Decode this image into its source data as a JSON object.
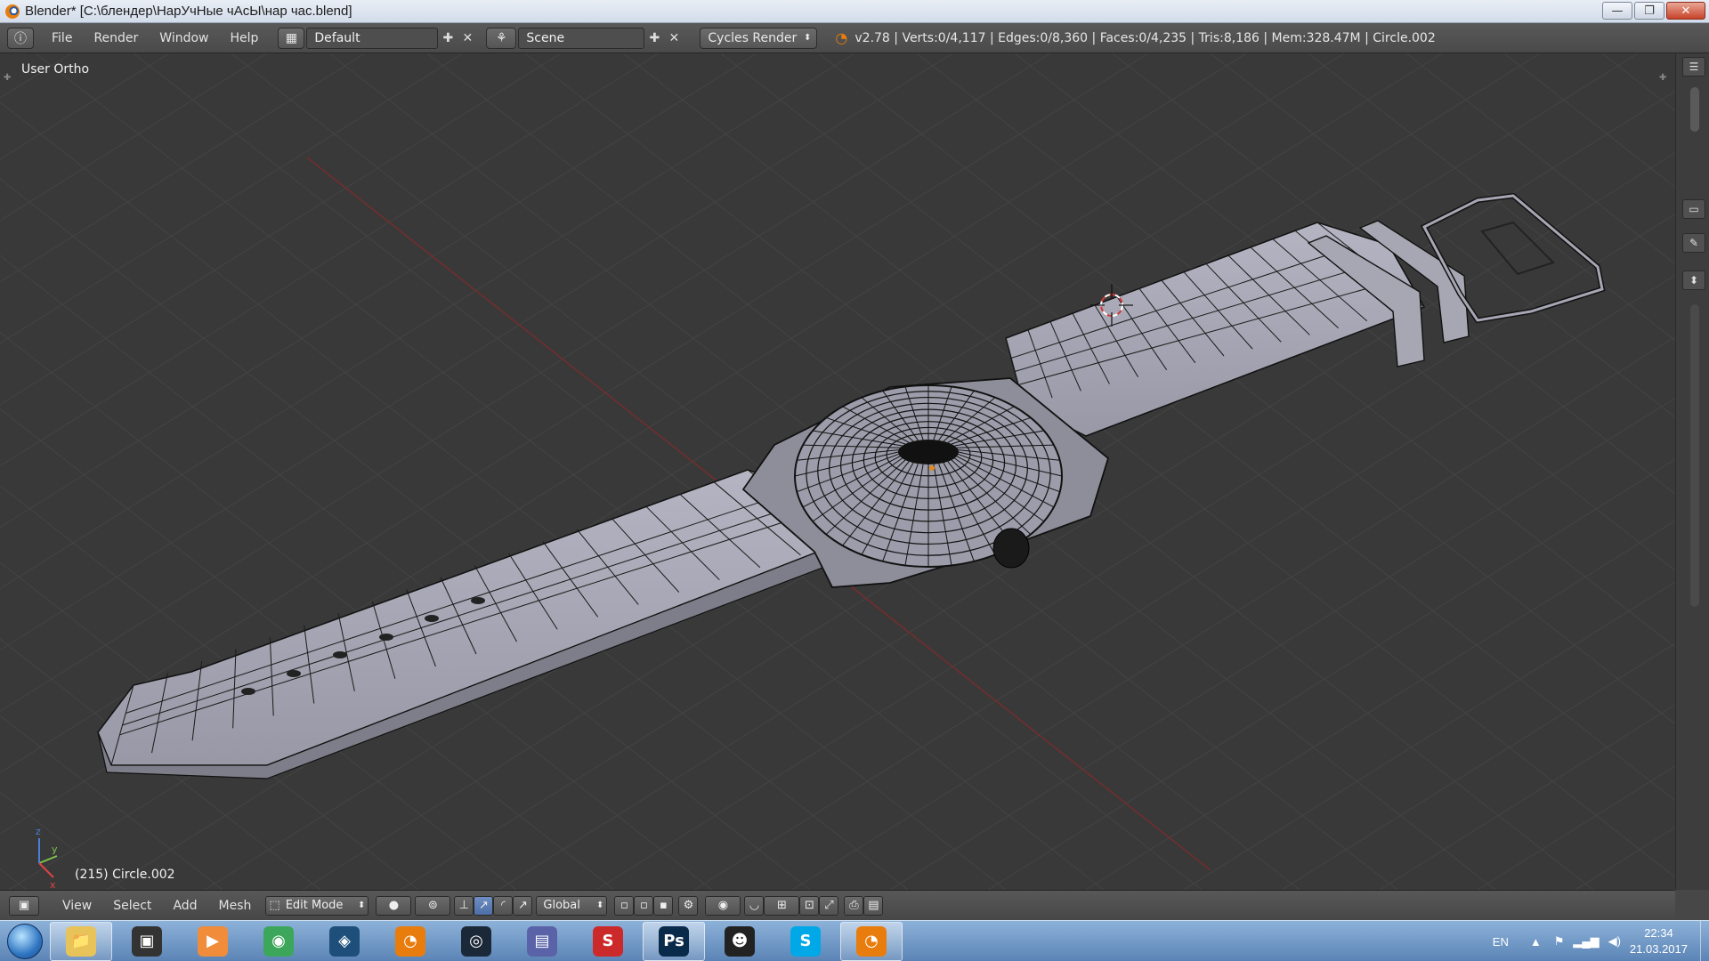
{
  "window": {
    "title": "Blender* [C:\\блендер\\НарУчНые чАсЫ\\нар час.blend]",
    "buttons": {
      "minimize": "—",
      "maximize": "❐",
      "close": "✕"
    }
  },
  "info_header": {
    "menus": [
      "File",
      "Render",
      "Window",
      "Help"
    ],
    "screen_layout": "Default",
    "scene": "Scene",
    "render_engine": "Cycles Render",
    "stats": "v2.78 | Verts:0/4,117 | Edges:0/8,360 | Faces:0/4,235 | Tris:8,186 | Mem:328.47M | Circle.002"
  },
  "viewport": {
    "view_name": "User Ortho",
    "object_label": "(215) Circle.002",
    "axis_labels": {
      "x": "x",
      "y": "y",
      "z": "z"
    }
  },
  "view3d_header": {
    "menus": [
      "View",
      "Select",
      "Add",
      "Mesh"
    ],
    "mode": "Edit Mode",
    "transform_orientation": "Global"
  },
  "taskbar": {
    "apps": [
      {
        "name": "explorer",
        "label": "📁",
        "color": "#e8c35a"
      },
      {
        "name": "app-2",
        "label": "▣",
        "color": "#333333"
      },
      {
        "name": "media",
        "label": "▶",
        "color": "#f08c3a"
      },
      {
        "name": "chrome",
        "label": "◉",
        "color": "#3ca75a"
      },
      {
        "name": "app-5",
        "label": "◈",
        "color": "#1d4f7a"
      },
      {
        "name": "blender-1",
        "label": "◔",
        "color": "#e87d0d"
      },
      {
        "name": "steam",
        "label": "◎",
        "color": "#1b2838"
      },
      {
        "name": "app-8",
        "label": "▤",
        "color": "#5a63a8"
      },
      {
        "name": "app-9",
        "label": "S",
        "color": "#cc2a2a"
      },
      {
        "name": "photoshop",
        "label": "Ps",
        "color": "#0a2a4a"
      },
      {
        "name": "app-11",
        "label": "☻",
        "color": "#222222"
      },
      {
        "name": "skype",
        "label": "S",
        "color": "#00a8e8"
      },
      {
        "name": "blender-2",
        "label": "◔",
        "color": "#e87d0d"
      }
    ],
    "language": "EN",
    "time": "22:34",
    "date": "21.03.2017"
  },
  "colors": {
    "viewport_bg": "#393939",
    "grid": "#454545",
    "mesh_fill": "#a9a9b6",
    "wire": "#101010",
    "x_axis": "#8a2e2e"
  }
}
